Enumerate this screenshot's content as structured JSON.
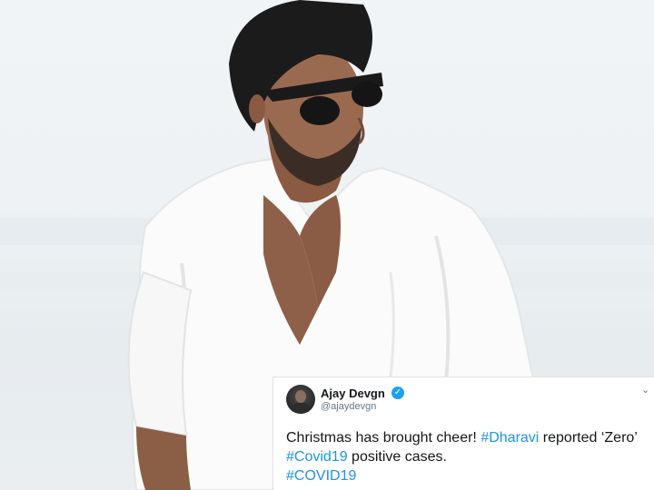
{
  "tweet": {
    "author_name": "Ajay Devgn",
    "handle": "@ajaydevgn",
    "verified_icon": "verified-badge-icon",
    "menu_icon": "chevron-down-icon",
    "line1_text": "Christmas has brought cheer! ",
    "hashtag_dharavi": "#Dharavi",
    "line1_rest": " reported ‘Zero’",
    "hashtag_covid19": "#Covid19",
    "line2_rest": " positive cases.",
    "hashtag_covid19_upper": "#COVID19",
    "colors": {
      "hashtag": "#1b95e0",
      "verified": "#1da1f2"
    }
  },
  "photo": {
    "subject": "man in sunglasses and white shirt on a bright beach"
  }
}
